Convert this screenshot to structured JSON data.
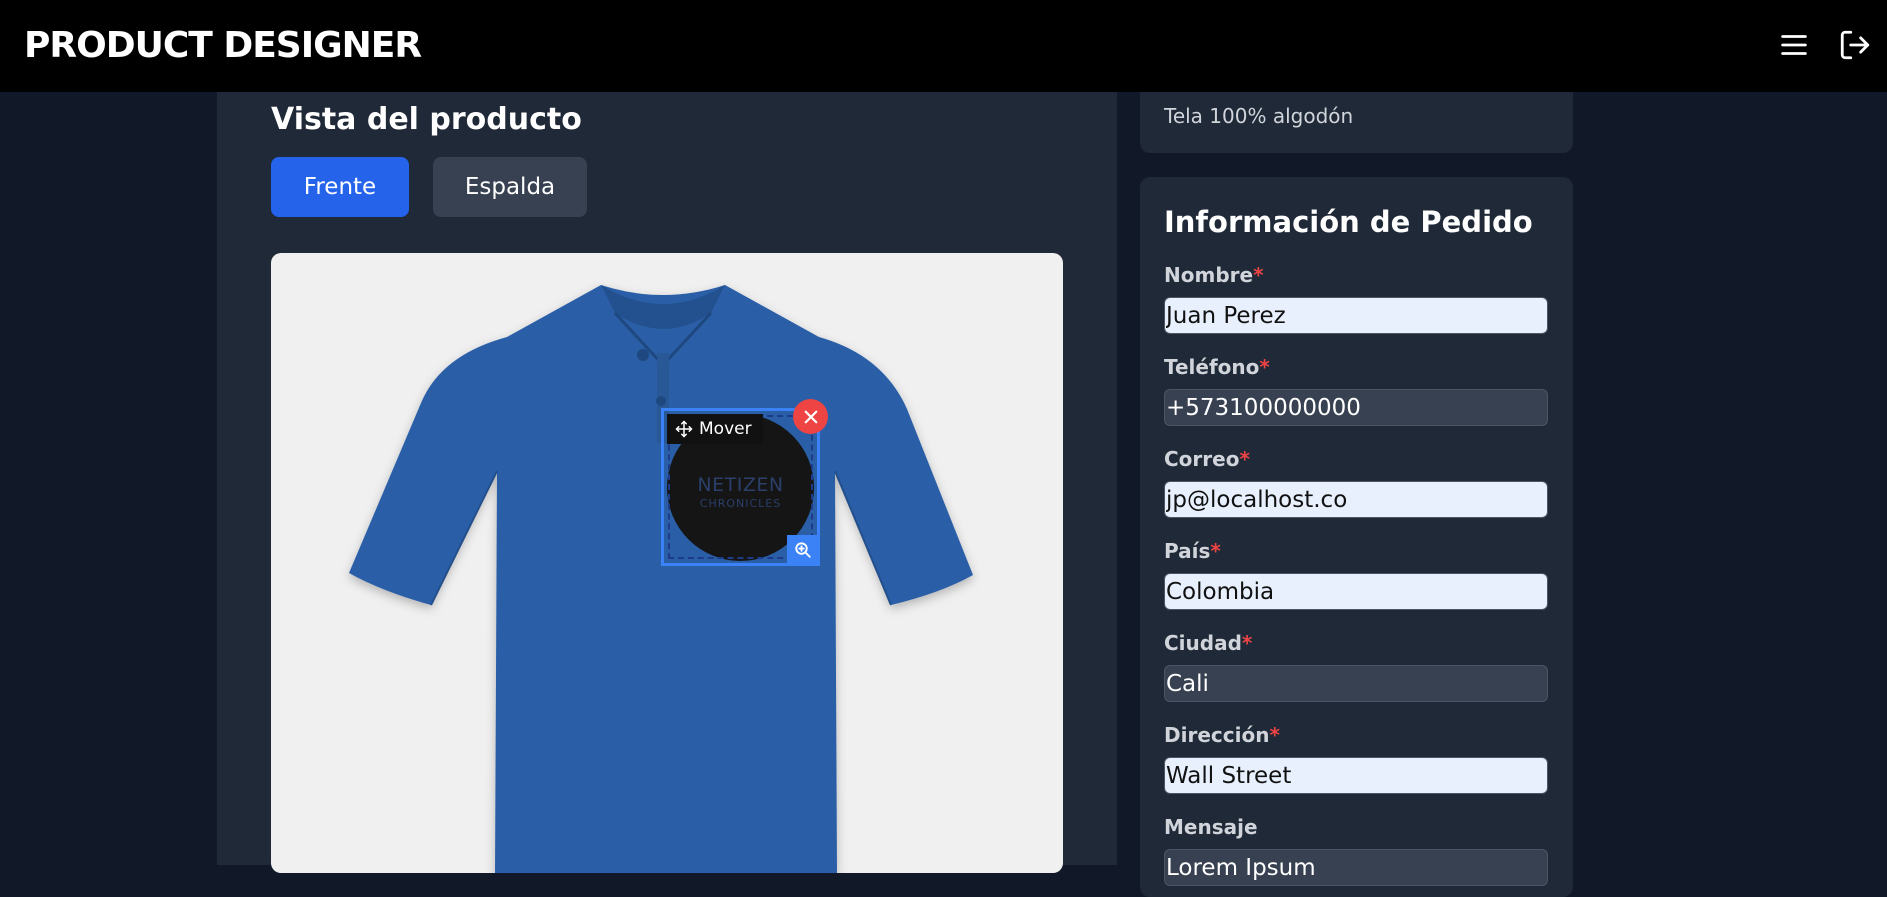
{
  "header": {
    "title": "PRODUCT DESIGNER"
  },
  "product_view": {
    "title": "Vista del producto",
    "tabs": [
      {
        "label": "Frente",
        "active": true
      },
      {
        "label": "Espalda",
        "active": false
      }
    ],
    "shirt_color": "#2c5fa8",
    "design": {
      "logo_line1": "NETIZEN",
      "logo_line2": "CHRONICLES",
      "move_label": "Mover"
    }
  },
  "product_info": {
    "material": "Tela 100% algodón"
  },
  "order_form": {
    "title": "Información de Pedido",
    "required_mark": "*",
    "fields": [
      {
        "label": "Nombre",
        "value": "Juan Perez"
      },
      {
        "label": "Teléfono",
        "value": "+573100000000"
      },
      {
        "label": "Correo",
        "value": "jp@localhost.co"
      },
      {
        "label": "País",
        "value": "Colombia"
      },
      {
        "label": "Ciudad",
        "value": "Cali"
      },
      {
        "label": "Dirección",
        "value": "Wall Street"
      },
      {
        "label": "Mensaje",
        "value": "Lorem Ipsum"
      }
    ]
  },
  "colors": {
    "accent": "#2563eb",
    "danger": "#ef4444",
    "panel": "#1f2937",
    "background": "#111827"
  }
}
